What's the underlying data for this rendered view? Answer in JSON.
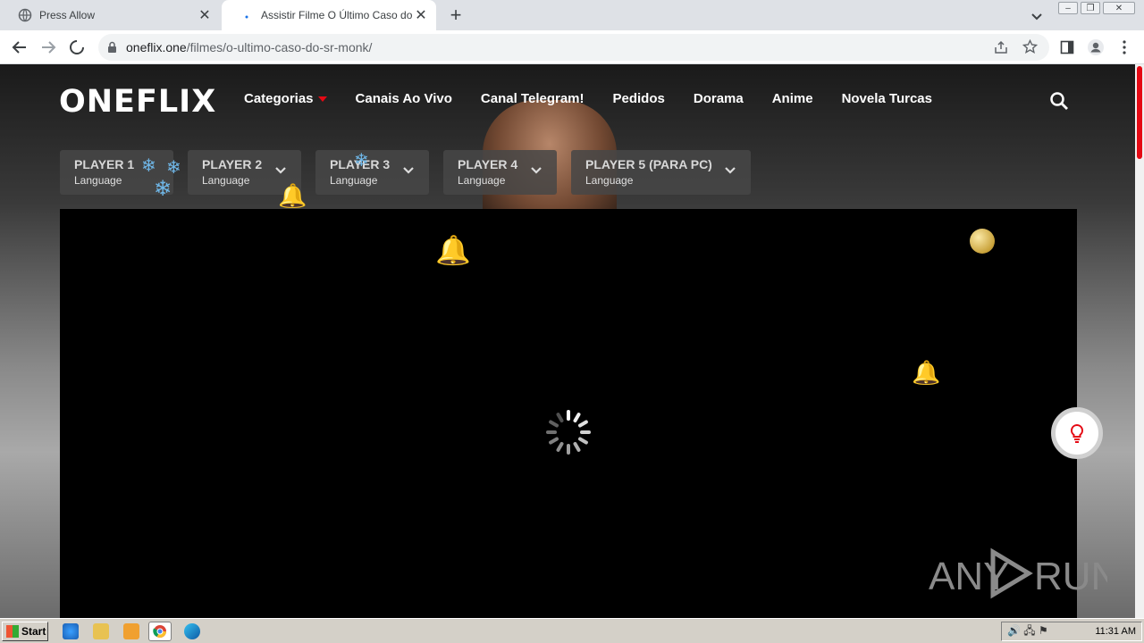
{
  "browser": {
    "tabs": [
      {
        "title": "Press Allow",
        "active": false
      },
      {
        "title": "Assistir Filme O Último Caso do Sr. M",
        "active": true
      }
    ],
    "new_tab_symbol": "+",
    "close_symbol": "✕",
    "url_domain": "oneflix.one",
    "url_path": "/filmes/o-ultimo-caso-do-sr-monk/"
  },
  "site": {
    "logo": "ONEFLIX",
    "nav": [
      "Categorias",
      "Canais Ao Vivo",
      "Canal Telegram!",
      "Pedidos",
      "Dorama",
      "Anime",
      "Novela Turcas"
    ],
    "players": [
      {
        "name": "PLAYER 1",
        "lang": "Language"
      },
      {
        "name": "PLAYER 2",
        "lang": "Language"
      },
      {
        "name": "PLAYER 3",
        "lang": "Language"
      },
      {
        "name": "PLAYER 4",
        "lang": "Language"
      },
      {
        "name": "PLAYER 5 (PARA PC)",
        "lang": "Language"
      }
    ],
    "watermark": "ANY RUN",
    "accent_color": "#e50914"
  },
  "taskbar": {
    "start_label": "Start",
    "clock": "11:31 AM"
  }
}
